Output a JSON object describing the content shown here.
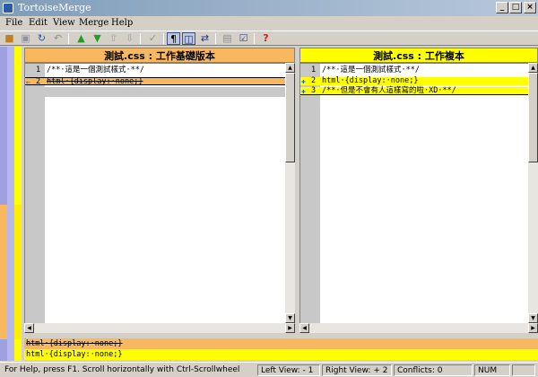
{
  "window": {
    "title": "TortoiseMerge",
    "min": "_",
    "max": "□",
    "close": "×"
  },
  "menu": [
    {
      "label": "File"
    },
    {
      "label": "Edit"
    },
    {
      "label": "View"
    },
    {
      "label": "Merge"
    },
    {
      "label": "Help"
    }
  ],
  "colors": {
    "base_header": "#f8b860",
    "mine_header": "#ffff00",
    "removed_line": "#f8b860",
    "added_line": "#ffff00",
    "accent": "#1060c0"
  },
  "left_pane": {
    "header": "測試.css : 工作基礎版本",
    "lines": [
      {
        "num": "1",
        "text": "/**·這是一個測試樣式·**/",
        "state": "normal",
        "marker": ""
      },
      {
        "num": "2",
        "text": "html·{display:·none;}",
        "state": "removed",
        "marker": "←"
      },
      {
        "num": "",
        "text": "",
        "state": "empty",
        "marker": ""
      }
    ]
  },
  "right_pane": {
    "header": "測試.css : 工作複本",
    "lines": [
      {
        "num": "1",
        "text": "/**·這是一個測試樣式·**/",
        "state": "normal",
        "marker": ""
      },
      {
        "num": "2",
        "text": "html·{display:·none;}",
        "state": "added",
        "marker": "✚"
      },
      {
        "num": "3",
        "text": "/**·但是不會有人這樣寫的啦·XD·**/",
        "state": "added",
        "marker": "✚"
      }
    ]
  },
  "bottom_view": {
    "line1": "html·{display:·none;}",
    "line2": "html·{display:·none;}"
  },
  "status": {
    "help": "For Help, press F1. Scroll horizontally with Ctrl-Scrollwheel",
    "left_view": "Left View: - 1",
    "right_view": "Right View: + 2",
    "conflicts": "Conflicts: 0",
    "num": "NUM"
  }
}
